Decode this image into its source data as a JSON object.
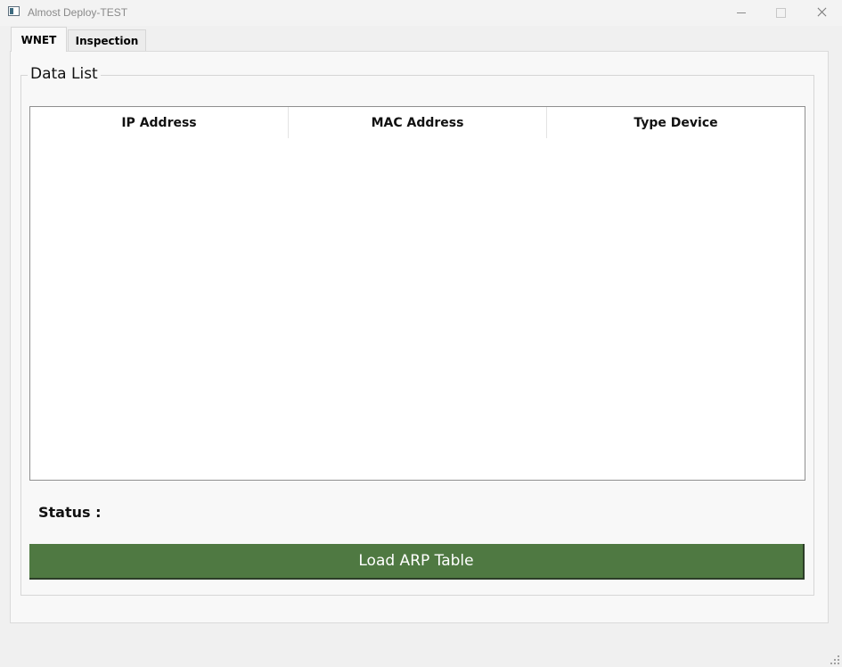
{
  "window": {
    "title": "Almost Deploy-TEST"
  },
  "tabs": [
    {
      "label": "WNET",
      "active": true
    },
    {
      "label": "Inspection",
      "active": false
    }
  ],
  "group": {
    "title": "Data List"
  },
  "table": {
    "columns": [
      "IP Address",
      "MAC Address",
      "Type Device"
    ],
    "rows": []
  },
  "status": {
    "label": "Status :",
    "value": ""
  },
  "actions": {
    "load_label": "Load ARP Table"
  },
  "colors": {
    "button_bg": "#4f7942",
    "button_text": "#ffffff"
  },
  "icons": {
    "app": "app-window-icon",
    "minimize": "minimize-icon",
    "maximize": "maximize-icon",
    "close": "close-icon",
    "grip": "resize-grip-icon"
  }
}
